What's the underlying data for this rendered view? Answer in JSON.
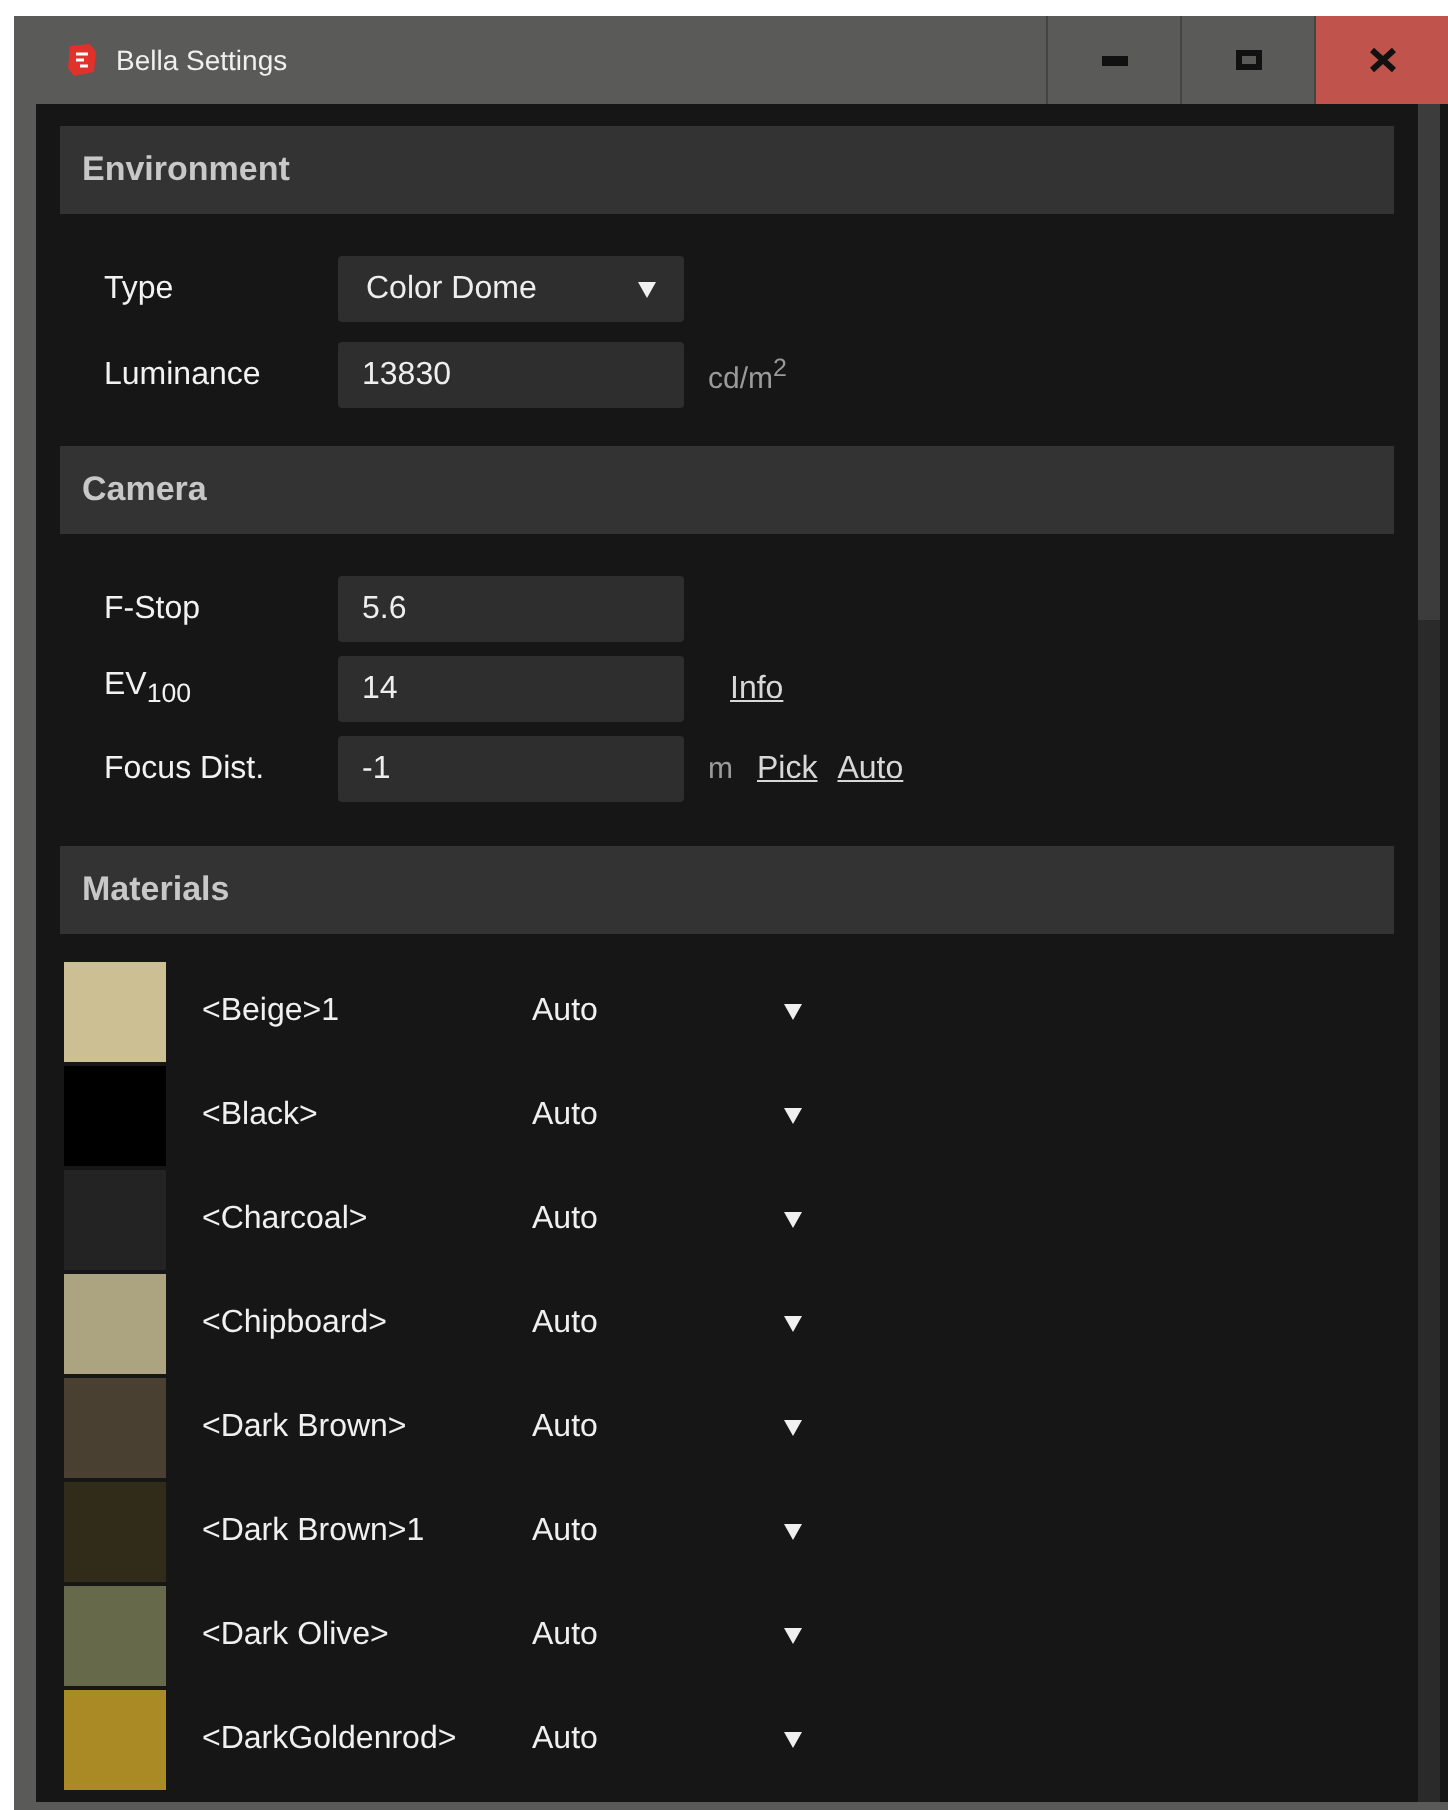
{
  "window": {
    "title": "Bella Settings",
    "controls": [
      {
        "kind": "minimize"
      },
      {
        "kind": "maximize"
      },
      {
        "kind": "close"
      }
    ]
  },
  "environment": {
    "title": "Environment",
    "type": {
      "label": "Type",
      "value": "Color Dome"
    },
    "luminance": {
      "label": "Luminance",
      "value": "13830",
      "unit": "cd/m$^{2}$"
    }
  },
  "camera": {
    "title": "Camera",
    "fields": [
      {
        "label": "F-Stop",
        "value": "5.6"
      },
      {
        "label": "EV$_{100}$",
        "value": "14",
        "links": [
          "Info"
        ]
      },
      {
        "label": "Focus Dist.",
        "value": "-1",
        "unit": "m",
        "links": [
          "Pick",
          "Auto"
        ]
      }
    ]
  },
  "materials": {
    "title": "Materials",
    "items": [
      {
        "name": "<Beige>1",
        "mode": "Auto",
        "color": "#cdbf94"
      },
      {
        "name": "<Black>",
        "mode": "Auto",
        "color": "#000000"
      },
      {
        "name": "<Charcoal>",
        "mode": "Auto",
        "color": "#232323"
      },
      {
        "name": "<Chipboard>",
        "mode": "Auto",
        "color": "#aca381"
      },
      {
        "name": "<Dark Brown>",
        "mode": "Auto",
        "color": "#4a4031"
      },
      {
        "name": "<Dark Brown>1",
        "mode": "Auto",
        "color": "#302c19"
      },
      {
        "name": "<Dark Olive>",
        "mode": "Auto",
        "color": "#666a4b"
      },
      {
        "name": "<DarkGoldenrod>",
        "mode": "Auto",
        "color": "#a98a25"
      }
    ]
  }
}
